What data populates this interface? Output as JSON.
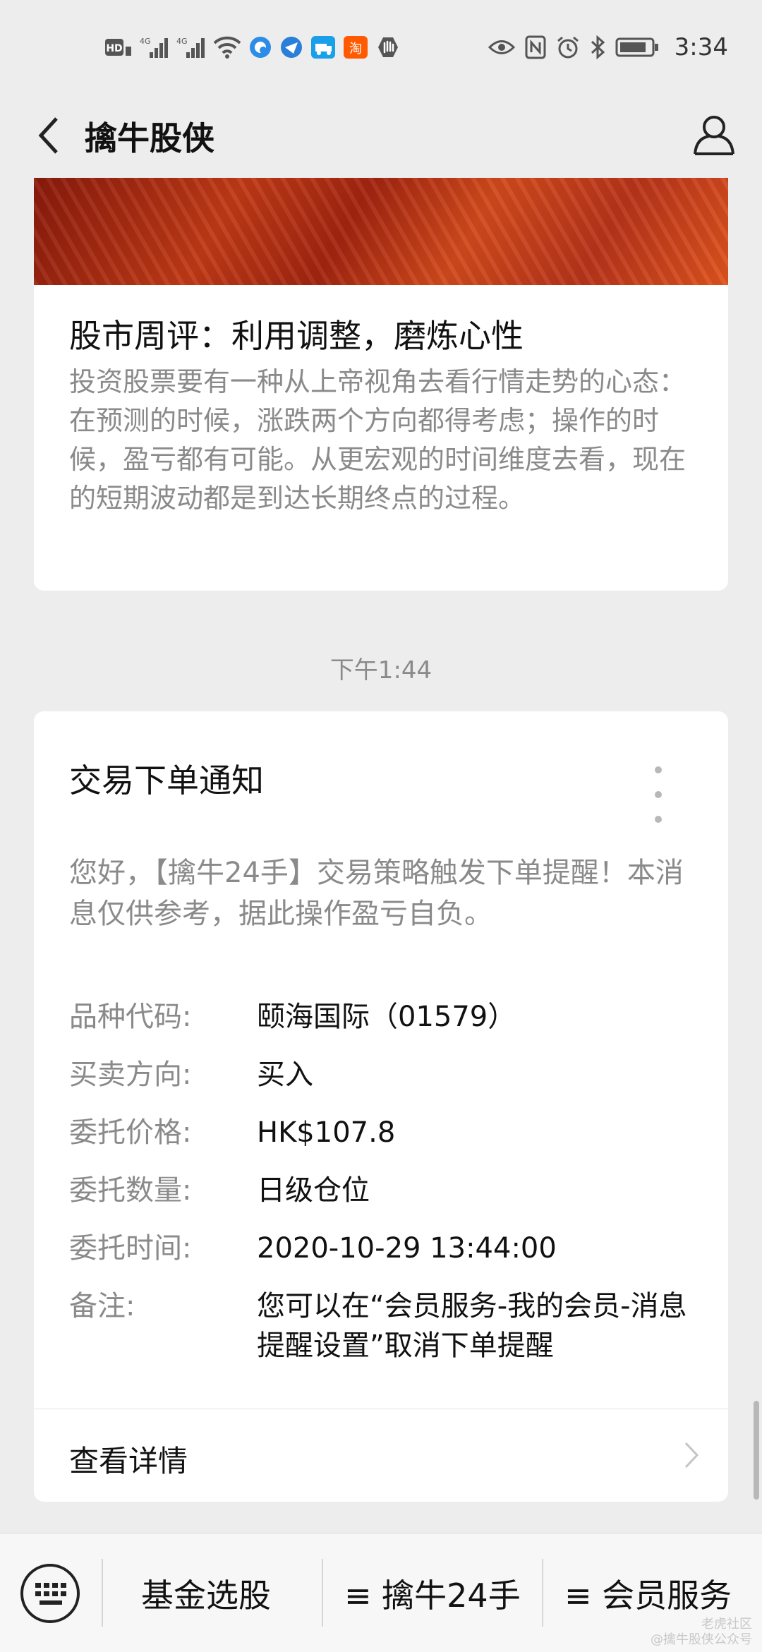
{
  "status_bar": {
    "time": "3:34",
    "left_icons": [
      "hd-icon",
      "signal-4g-icon",
      "signal-4g-icon",
      "wifi-icon",
      "app-notification-icon",
      "app-notification-icon",
      "app-notification-icon",
      "taobao-icon",
      "hand-icon"
    ],
    "taobao_label": "淘",
    "hd_label": "HD",
    "right_icons": [
      "eye-icon",
      "nfc-icon",
      "alarm-icon",
      "bluetooth-icon",
      "battery-icon"
    ]
  },
  "nav": {
    "title": "擒牛股侠"
  },
  "article": {
    "title": "股市周评：利用调整，磨炼心性",
    "summary": "投资股票要有一种从上帝视角去看行情走势的心态：在预测的时候，涨跌两个方向都得考虑；操作的时候，盈亏都有可能。从更宏观的时间维度去看，现在的短期波动都是到达长期终点的过程。"
  },
  "timestamp": "下午1:44",
  "notice": {
    "title": "交易下单通知",
    "intro": "您好，【擒牛24手】交易策略触发下单提醒！本消息仅供参考，据此操作盈亏自负。",
    "fields": [
      {
        "label": "品种代码:",
        "value": "颐海国际（01579）"
      },
      {
        "label": "买卖方向:",
        "value": "买入"
      },
      {
        "label": "委托价格:",
        "value": "HK$107.8"
      },
      {
        "label": "委托数量:",
        "value": "日级仓位"
      },
      {
        "label": "委托时间:",
        "value": "2020-10-29 13:44:00"
      },
      {
        "label": "备注:",
        "value": "您可以在“会员服务-我的会员-消息提醒设置”取消下单提醒"
      }
    ],
    "detail_label": "查看详情"
  },
  "bottom_menu": {
    "items": [
      "基金选股",
      "≡ 擒牛24手",
      "≡ 会员服务"
    ]
  },
  "watermark": {
    "line1": "老虎社区",
    "line2": "@擒牛股侠公众号"
  }
}
